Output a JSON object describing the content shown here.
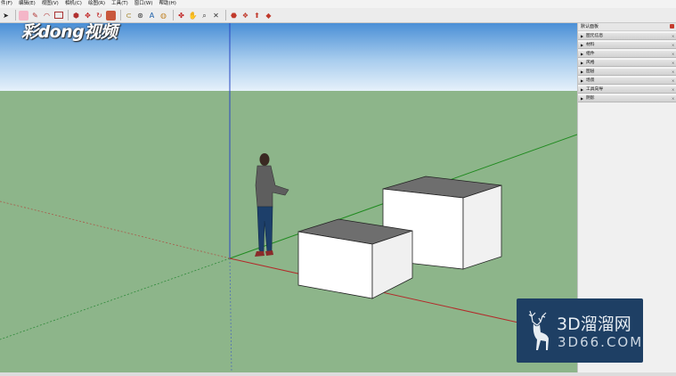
{
  "menu": {
    "items": [
      "件(F)",
      "编辑(E)",
      "视图(V)",
      "相机(C)",
      "绘图(R)",
      "工具(T)",
      "窗口(W)",
      "帮助(H)"
    ]
  },
  "toolbar": {
    "icons": [
      "select-icon",
      "eraser-icon",
      "pencil-icon",
      "arc-icon",
      "rectangle-icon",
      "push-pull-icon",
      "move-icon",
      "rotate-icon",
      "scale-icon",
      "offset-icon",
      "tape-measure-icon",
      "text-icon",
      "paint-bucket-icon",
      "orbit-icon",
      "pan-icon",
      "zoom-icon",
      "zoom-extents-icon",
      "warehouse-icon",
      "component-icon",
      "share-icon",
      "extension-icon"
    ]
  },
  "tray": {
    "title": "默认面板",
    "panels": [
      "图元信息",
      "材料",
      "组件",
      "风格",
      "图层",
      "场景",
      "工具向导",
      "阴影"
    ]
  },
  "brand": {
    "text": "彩dong视频"
  },
  "badge": {
    "main": "3D溜溜网",
    "sub": "3D66.COM"
  },
  "colors": {
    "sky_top": "#4a8fd6",
    "sky_bottom": "#e6f1fa",
    "ground": "#8db58a",
    "box_top": "#6e6e6e",
    "box_side": "#ffffff",
    "badge_bg": "#1e3f64"
  }
}
